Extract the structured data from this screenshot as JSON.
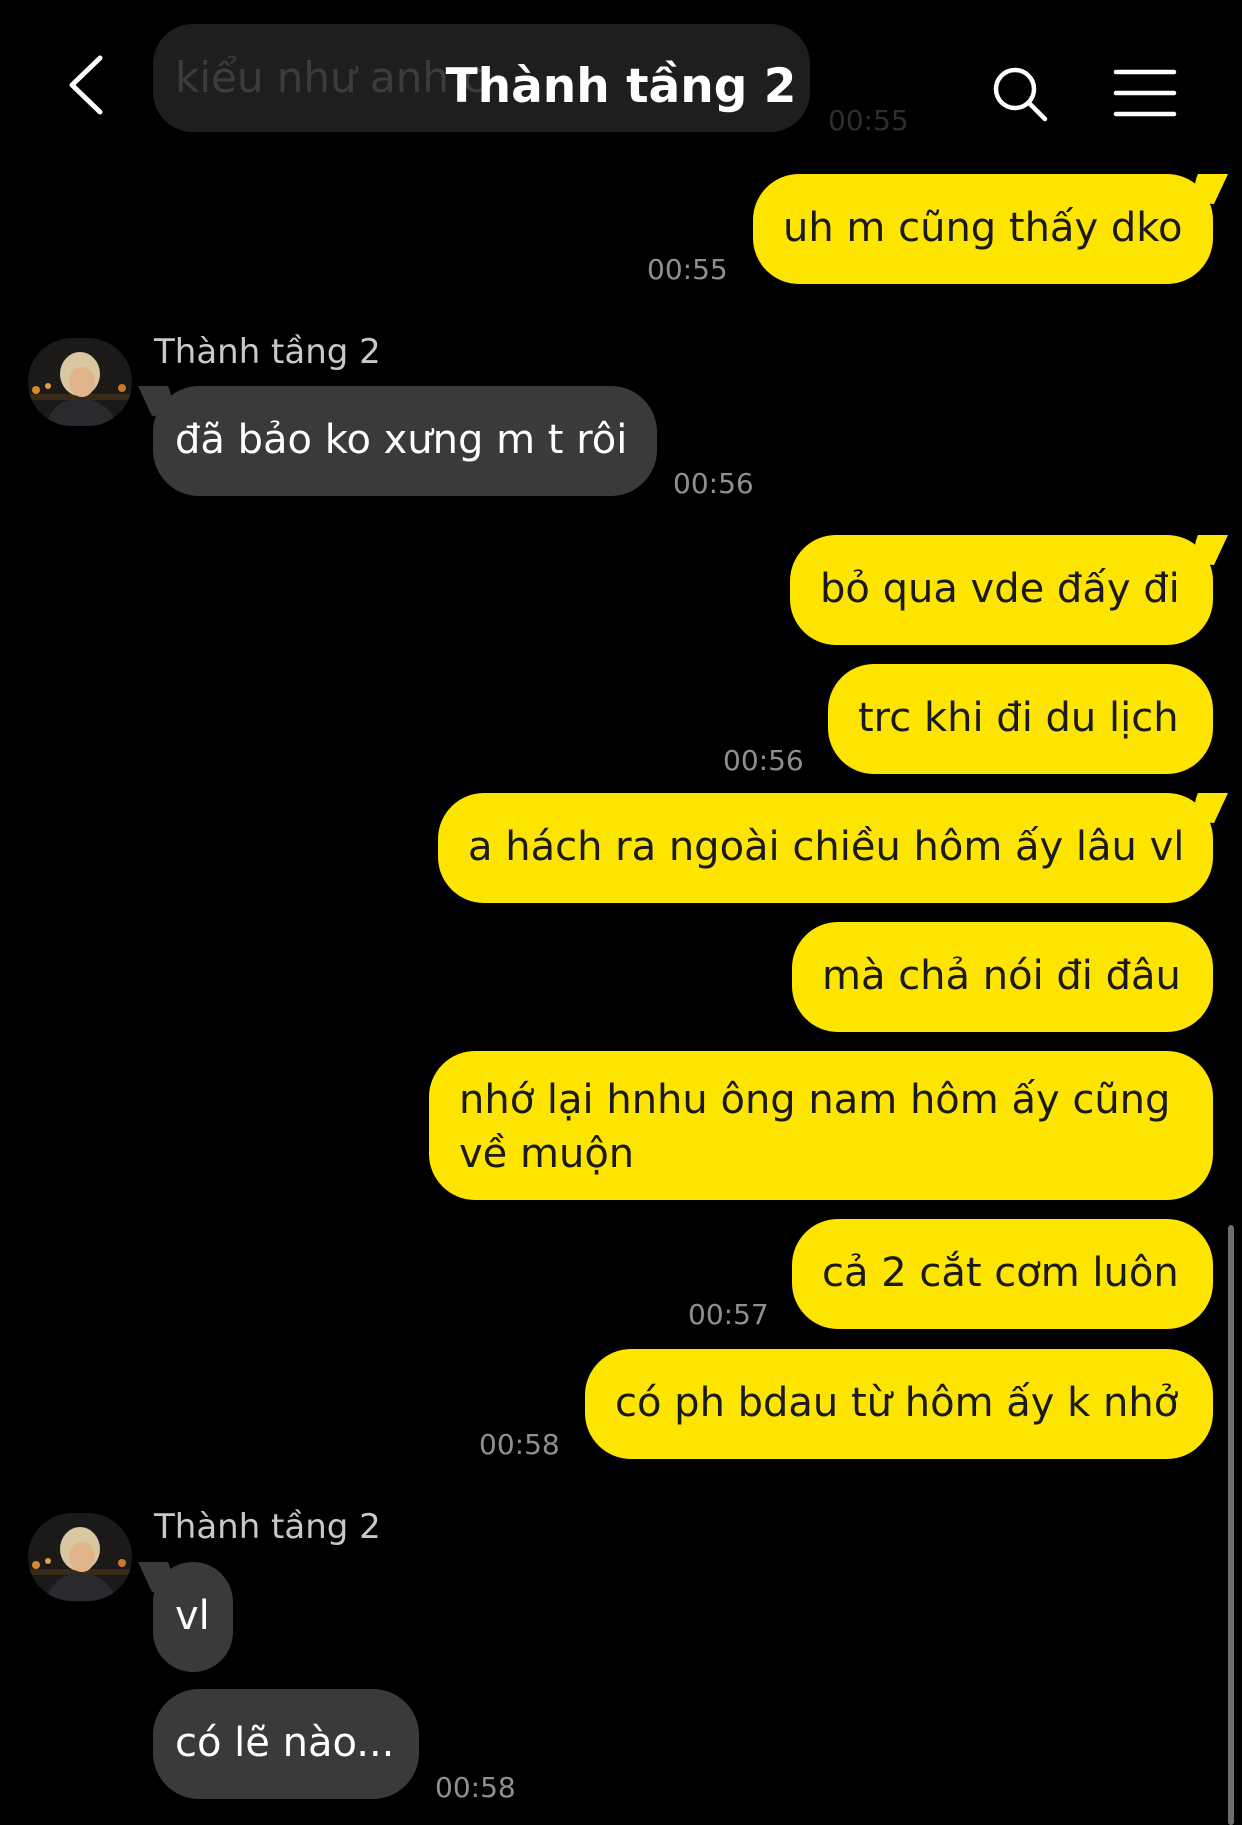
{
  "header": {
    "title": "Thành tầng 2",
    "back_icon": "chevron-left-icon",
    "search_icon": "search-icon",
    "menu_icon": "hamburger-menu-icon"
  },
  "colors": {
    "background": "#000000",
    "sent_bubble": "#fee500",
    "received_bubble": "#3a3a3c",
    "timestamp": "#8e8e93"
  },
  "faded_message": {
    "text": "kiểu như anh c",
    "time": "00:55"
  },
  "messages": [
    {
      "direction": "sent",
      "text": "uh m cũng thấy dko",
      "time": "00:55"
    },
    {
      "direction": "received",
      "sender": "Thành tầng 2",
      "text": "đã bảo ko xưng m t rôi",
      "time": "00:56"
    },
    {
      "direction": "sent",
      "text": "bỏ qua vde đấy đi"
    },
    {
      "direction": "sent",
      "text": "trc khi đi du lịch",
      "time": "00:56"
    },
    {
      "direction": "sent",
      "text": "a hách ra ngoài chiều hôm ấy lâu vl"
    },
    {
      "direction": "sent",
      "text": "mà chả nói đi đâu"
    },
    {
      "direction": "sent",
      "text": "nhớ lại hnhu ông nam hôm ấy cũng về muộn"
    },
    {
      "direction": "sent",
      "text": "cả 2 cắt cơm luôn",
      "time": "00:57"
    },
    {
      "direction": "sent",
      "text": "có ph bdau từ hôm ấy k nhở",
      "time": "00:58"
    },
    {
      "direction": "received",
      "sender": "Thành tầng 2",
      "text": "vl"
    },
    {
      "direction": "received",
      "text": "có lẽ nào...",
      "time": "00:58"
    }
  ]
}
